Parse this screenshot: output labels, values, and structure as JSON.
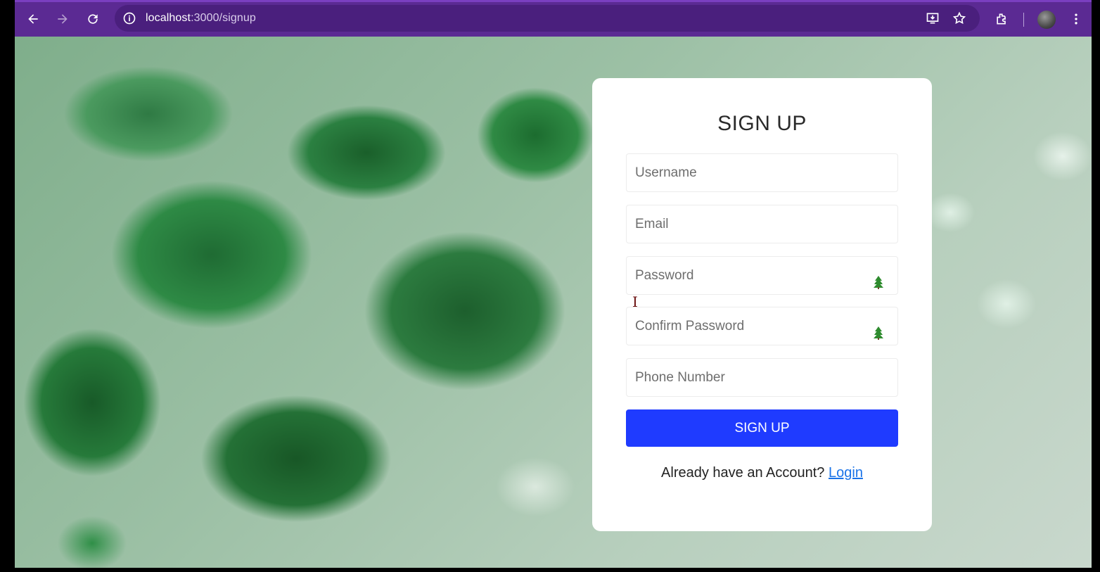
{
  "browser": {
    "url_host": "localhost",
    "url_path": ":3000/signup",
    "accent": "#5b2a93"
  },
  "form": {
    "title": "SIGN UP",
    "username_placeholder": "Username",
    "email_placeholder": "Email",
    "password_placeholder": "Password",
    "confirm_password_placeholder": "Confirm Password",
    "phone_placeholder": "Phone Number",
    "submit_label": "SIGN UP",
    "submit_color": "#1f3bff",
    "footer_text": "Already have an Account?",
    "login_link": "Login"
  },
  "icons": {
    "password_toggle": "tree-icon",
    "confirm_password_toggle": "tree-icon"
  }
}
